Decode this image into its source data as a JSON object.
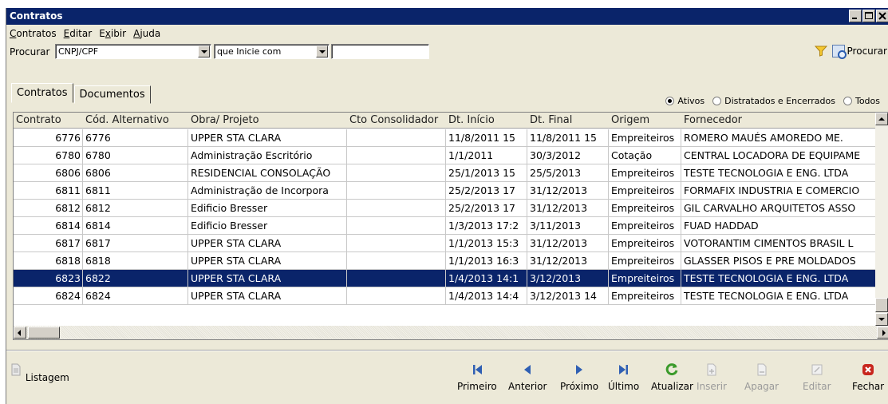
{
  "window": {
    "title": "Contratos"
  },
  "menu": {
    "items": [
      {
        "label": "Contratos",
        "ul": "C"
      },
      {
        "label": "Editar",
        "ul": "E"
      },
      {
        "label": "Exibir",
        "ul": "x"
      },
      {
        "label": "Ajuda",
        "ul": "A"
      }
    ]
  },
  "search": {
    "label": "Procurar",
    "field_value": "CNPJ/CPF",
    "mode_value": "que Inicie com",
    "text_value": "",
    "button_label": "Procurar"
  },
  "tabs": [
    {
      "label": "Contratos",
      "active": true
    },
    {
      "label": "Documentos",
      "active": false
    }
  ],
  "filter": {
    "options": [
      {
        "label": "Ativos",
        "checked": true
      },
      {
        "label": "Distratados e Encerrados",
        "checked": false
      },
      {
        "label": "Todos",
        "checked": false
      }
    ]
  },
  "grid": {
    "columns": [
      "Contrato",
      "Cód. Alternativo",
      "Obra/ Projeto",
      "Cto Consolidador",
      "Dt. Início",
      "Dt. Final",
      "Origem",
      "Fornecedor"
    ],
    "rows": [
      [
        "6776",
        "6776",
        "UPPER STA CLARA",
        "",
        "11/8/2011 15",
        "11/8/2011 15",
        "Empreiteiros",
        "ROMERO MAUÉS AMOREDO ME."
      ],
      [
        "6780",
        "6780",
        "Administração Escritório",
        "",
        "1/1/2011",
        "30/3/2012",
        "Cotação",
        "CENTRAL LOCADORA DE EQUIPAME"
      ],
      [
        "6806",
        "6806",
        "RESIDENCIAL CONSOLAÇÃO",
        "",
        "25/1/2013 15",
        "25/5/2013",
        "Empreiteiros",
        "TESTE TECNOLOGIA E ENG. LTDA"
      ],
      [
        "6811",
        "6811",
        "Administração de Incorpora",
        "",
        "25/2/2013 17",
        "31/12/2013",
        "Empreiteiros",
        "FORMAFIX INDUSTRIA E COMERCIO"
      ],
      [
        "6812",
        "6812",
        "Edificio Bresser",
        "",
        "25/2/2013 17",
        "31/12/2013",
        "Empreiteiros",
        "GIL CARVALHO ARQUITETOS ASSO"
      ],
      [
        "6814",
        "6814",
        "Edificio Bresser",
        "",
        "1/3/2013 17:2",
        "3/11/2013",
        "Empreiteiros",
        "FUAD HADDAD"
      ],
      [
        "6817",
        "6817",
        "UPPER STA CLARA",
        "",
        "1/1/2013 15:3",
        "31/12/2013",
        "Empreiteiros",
        "VOTORANTIM CIMENTOS BRASIL L"
      ],
      [
        "6818",
        "6818",
        "UPPER STA CLARA",
        "",
        "1/1/2013 16:3",
        "31/12/2013",
        "Empreiteiros",
        "GLASSER PISOS E PRE MOLDADOS"
      ],
      [
        "6823",
        "6822",
        "UPPER STA CLARA",
        "",
        "1/4/2013 14:1",
        "3/12/2013",
        "Empreiteiros",
        "TESTE TECNOLOGIA E ENG. LTDA"
      ],
      [
        "6824",
        "6824",
        "UPPER STA CLARA",
        "",
        "1/4/2013 14:4",
        "3/12/2013 14",
        "Empreiteiros",
        "TESTE TECNOLOGIA E ENG. LTDA"
      ]
    ],
    "selected_index": 8
  },
  "toolbar": {
    "listagem": "Listagem",
    "buttons": [
      {
        "label": "Primeiro",
        "icon": "first-icon",
        "enabled": true
      },
      {
        "label": "Anterior",
        "icon": "previous-icon",
        "enabled": true
      },
      {
        "label": "Próximo",
        "icon": "next-icon",
        "enabled": true
      },
      {
        "label": "Último",
        "icon": "last-icon",
        "enabled": true
      },
      {
        "label": "Atualizar",
        "icon": "refresh-icon",
        "enabled": true
      },
      {
        "label": "Inserir",
        "icon": "insert-icon",
        "enabled": false
      },
      {
        "label": "Apagar",
        "icon": "delete-icon",
        "enabled": false
      },
      {
        "label": "Editar",
        "icon": "edit-icon",
        "enabled": false
      },
      {
        "label": "Fechar",
        "icon": "close-icon",
        "enabled": true
      }
    ]
  },
  "colors": {
    "title_bar": "#0a246a",
    "selection": "#0a246a",
    "nav_blue": "#2f5fb3",
    "refresh_green": "#3a9a2a",
    "close_red": "#c8261e"
  }
}
